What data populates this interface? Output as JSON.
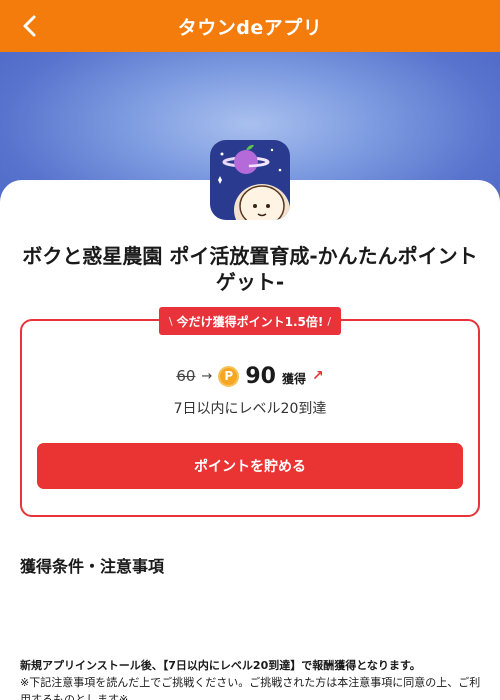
{
  "header": {
    "title": "タウンdeアプリ",
    "back_icon": "chevron-left-icon",
    "background_color": "#f47c0c"
  },
  "app": {
    "name": "ボクと惑星農園 ポイ活放置育成-かんたんポイントゲット-",
    "icon": "planet-farm-app-icon"
  },
  "campaign": {
    "badge_label": "今だけ獲得ポイント1.5倍!",
    "badge_slash_left": "\\",
    "badge_slash_right": "/",
    "old_points": "60",
    "arrow": "→",
    "coin_label": "P",
    "new_points": "90",
    "get_label": "獲得",
    "up_icon": "↗",
    "condition": "7日以内にレベル20到達",
    "cta_label": "ポイントを貯める",
    "accent_color": "#e8333a"
  },
  "terms": {
    "section_title": "獲得条件・注意事項",
    "line1": "新規アプリインストール後、【7日以内にレベル20到達】で報酬獲得となります。",
    "line2": "※下記注意事項を読んだ上でご挑戦ください。ご挑戦された方は本注意事項に同意の上、ご利用するものとします※"
  }
}
